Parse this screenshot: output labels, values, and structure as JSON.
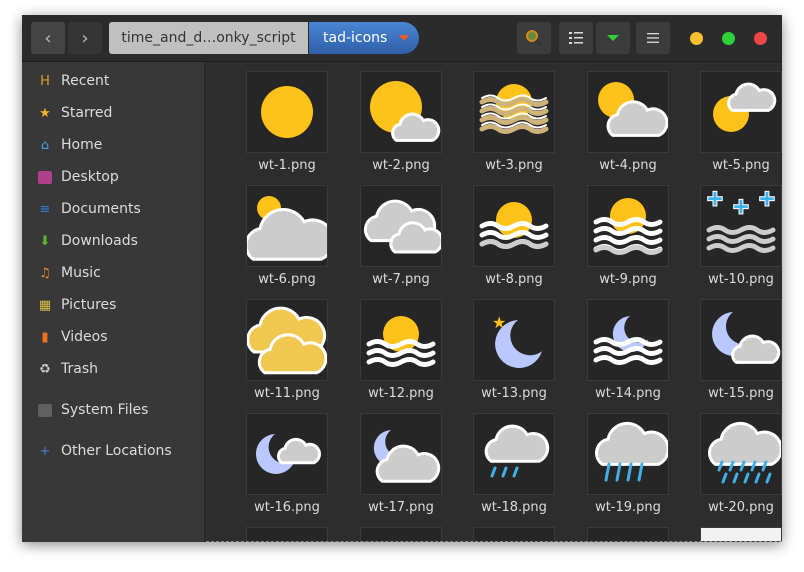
{
  "window": {
    "dots": {
      "minimize": "#f7c02c",
      "maximize": "#2ed13a",
      "close": "#f04545"
    }
  },
  "header": {
    "back_icon": "‹",
    "forward_icon": "›",
    "breadcrumbs": [
      {
        "label": "time_and_d…onky_script"
      },
      {
        "label": "tad-icons"
      }
    ],
    "search_icon": "search-icon",
    "view_list_icon": "list-view-icon",
    "view_options_icon": "dropdown-icon",
    "menu_icon": "hamburger-icon"
  },
  "sidebar": {
    "items": [
      {
        "label": "Recent",
        "icon": "recent-icon",
        "color": "#e0a030",
        "glyph": "H"
      },
      {
        "label": "Starred",
        "icon": "star-icon",
        "color": "#f7b52c",
        "glyph": "★"
      },
      {
        "label": "Home",
        "icon": "home-icon",
        "color": "#4aa3e8",
        "glyph": "⌂"
      },
      {
        "label": "Desktop",
        "icon": "desktop-icon",
        "color": "#b0408a",
        "glyph": ""
      },
      {
        "label": "Documents",
        "icon": "documents-icon",
        "color": "#2f7fd0",
        "glyph": "≡"
      },
      {
        "label": "Downloads",
        "icon": "downloads-icon",
        "color": "#5cb82e",
        "glyph": "⬇"
      },
      {
        "label": "Music",
        "icon": "music-icon",
        "color": "#f08c1c",
        "glyph": "♫"
      },
      {
        "label": "Pictures",
        "icon": "pictures-icon",
        "color": "#d8c040",
        "glyph": "▦"
      },
      {
        "label": "Videos",
        "icon": "videos-icon",
        "color": "#f07020",
        "glyph": "▮"
      },
      {
        "label": "Trash",
        "icon": "trash-icon",
        "color": "#cccccc",
        "glyph": "♻"
      },
      {
        "label": "System Files",
        "icon": "folder-icon",
        "color": "#606060",
        "glyph": ""
      },
      {
        "label": "Other Locations",
        "icon": "plus-icon",
        "color": "#4a80d0",
        "glyph": "+"
      }
    ]
  },
  "files": [
    {
      "name": "wt-1.png",
      "icon": "sun"
    },
    {
      "name": "wt-2.png",
      "icon": "sun-small-cloud"
    },
    {
      "name": "wt-3.png",
      "icon": "sun-sand-haze"
    },
    {
      "name": "wt-4.png",
      "icon": "sun-cloud"
    },
    {
      "name": "wt-5.png",
      "icon": "sun-high-cloud"
    },
    {
      "name": "wt-6.png",
      "icon": "mostly-cloudy"
    },
    {
      "name": "wt-7.png",
      "icon": "clouds"
    },
    {
      "name": "wt-8.png",
      "icon": "sun-fog"
    },
    {
      "name": "wt-9.png",
      "icon": "sun-fog-dense"
    },
    {
      "name": "wt-10.png",
      "icon": "freezing-fog"
    },
    {
      "name": "wt-11.png",
      "icon": "dust-clouds"
    },
    {
      "name": "wt-12.png",
      "icon": "sun-fog-light"
    },
    {
      "name": "wt-13.png",
      "icon": "moon-star"
    },
    {
      "name": "wt-14.png",
      "icon": "moon-fog"
    },
    {
      "name": "wt-15.png",
      "icon": "moon-cloud"
    },
    {
      "name": "wt-16.png",
      "icon": "moon-small-cloud"
    },
    {
      "name": "wt-17.png",
      "icon": "moon-cloudy"
    },
    {
      "name": "wt-18.png",
      "icon": "cloud-light-rain"
    },
    {
      "name": "wt-19.png",
      "icon": "cloud-rain"
    },
    {
      "name": "wt-20.png",
      "icon": "cloud-heavy-rain"
    }
  ],
  "colors": {
    "sun": "#ffc21a",
    "cloud": "#cccccc",
    "moon": "#b9c8ff",
    "rain": "#3fb0e8",
    "sand": "#cdb37a"
  }
}
